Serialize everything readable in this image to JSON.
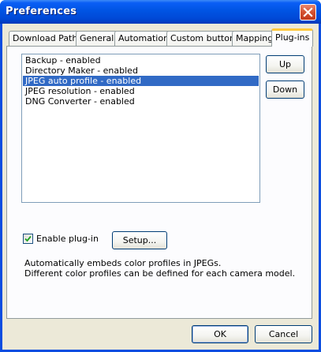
{
  "window": {
    "title": "Preferences"
  },
  "tabs": [
    {
      "label": "Download Path",
      "active": false
    },
    {
      "label": "General",
      "active": false
    },
    {
      "label": "Automation",
      "active": false
    },
    {
      "label": "Custom button",
      "active": false
    },
    {
      "label": "Mapping",
      "active": false
    },
    {
      "label": "Plug-ins",
      "active": true
    }
  ],
  "plugins": {
    "items": [
      {
        "label": "Backup - enabled",
        "selected": false
      },
      {
        "label": "Directory Maker - enabled",
        "selected": false
      },
      {
        "label": "JPEG auto profile - enabled",
        "selected": true
      },
      {
        "label": "JPEG resolution - enabled",
        "selected": false
      },
      {
        "label": "DNG Converter - enabled",
        "selected": false
      }
    ],
    "up_label": "Up",
    "down_label": "Down",
    "enable_label": "Enable plug-in",
    "enable_checked": true,
    "setup_label": "Setup...",
    "description_line1": "Automatically embeds color profiles in JPEGs.",
    "description_line2": "Different color profiles can be defined for each camera model."
  },
  "footer": {
    "ok_label": "OK",
    "cancel_label": "Cancel"
  },
  "colors": {
    "selection": "#316ac5",
    "titlebar": "#0054e3",
    "face": "#ece9d8"
  }
}
